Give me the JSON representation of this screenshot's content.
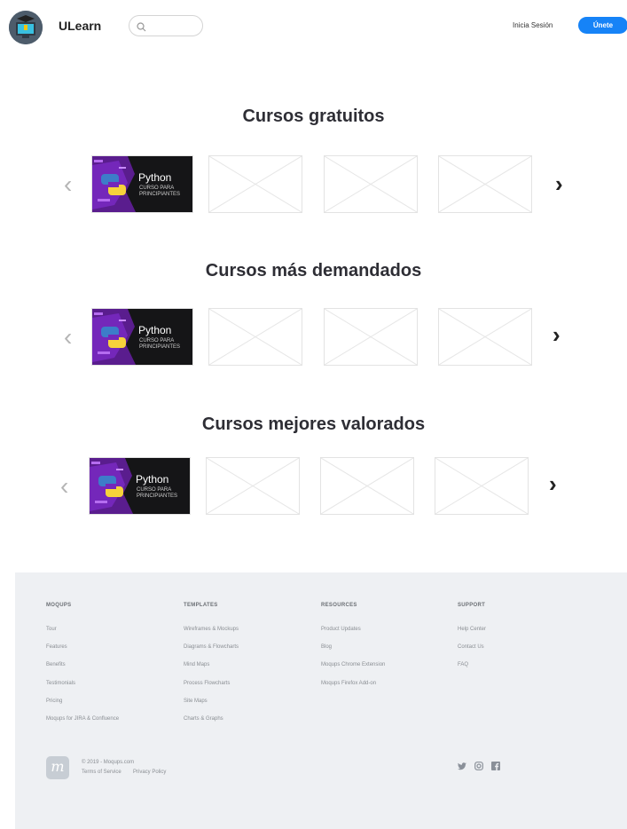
{
  "header": {
    "brand": "ULearn",
    "search_placeholder": "",
    "login_label": "Inicia Sesión",
    "join_label": "Únete"
  },
  "sections": [
    {
      "title": "Cursos gratuitos"
    },
    {
      "title": "Cursos más demandados"
    },
    {
      "title": "Cursos mejores valorados"
    }
  ],
  "course": {
    "title": "Python",
    "subtitle_line1": "CURSO PARA",
    "subtitle_line2": "PRINCIPIANTES"
  },
  "footer": {
    "columns": [
      {
        "heading": "MOQUPS",
        "links": [
          "Tour",
          "Features",
          "Benefits",
          "Testimonials",
          "Pricing",
          "Moqups for JIRA & Confluence"
        ]
      },
      {
        "heading": "TEMPLATES",
        "links": [
          "Wireframes & Mockups",
          "Diagrams & Flowcharts",
          "Mind Maps",
          "Process Flowcharts",
          "Site Maps",
          "Charts & Graphs"
        ]
      },
      {
        "heading": "RESOURCES",
        "links": [
          "Product Updates",
          "Blog",
          "Moqups Chrome Extension",
          "Moqups Firefox Add-on"
        ]
      },
      {
        "heading": "SUPPORT",
        "links": [
          "Help Center",
          "Contact Us",
          "FAQ"
        ]
      }
    ],
    "logo_letter": "m",
    "copyright": "© 2019 - Moqups.com",
    "terms": "Terms of Service",
    "privacy": "Privacy Policy",
    "social": [
      "twitter-icon",
      "instagram-icon",
      "facebook-icon"
    ]
  },
  "colors": {
    "accent": "#1683f7",
    "footer_bg": "#eef0f3",
    "course_bg": "#151517"
  }
}
